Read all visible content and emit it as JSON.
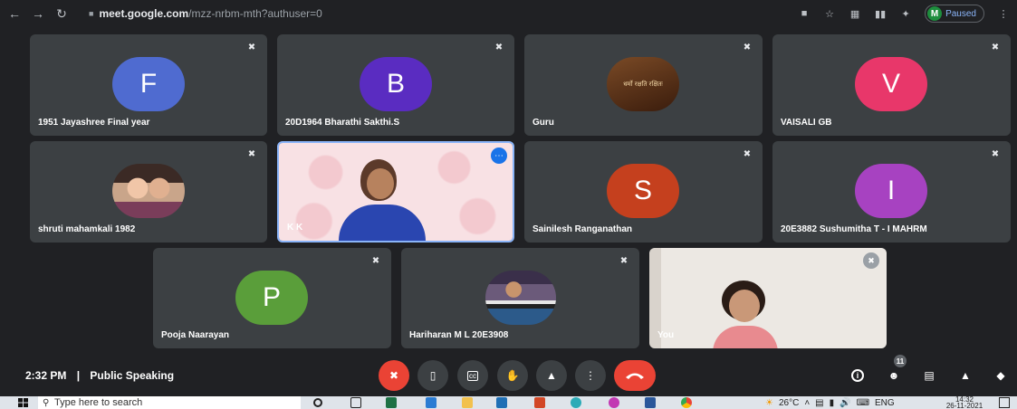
{
  "browser": {
    "url_host": "meet.google.com",
    "url_path": "/mzz-nrbm-mth?authuser=0",
    "profile_initial": "M",
    "profile_status": "Paused"
  },
  "tiles": [
    {
      "name": "1951 Jayashree Final year",
      "initial": "F",
      "color": "#4f6bd0"
    },
    {
      "name": "20D1964 Bharathi Sakthi.S",
      "initial": "B",
      "color": "#5a2cc1"
    },
    {
      "name": "Guru",
      "photo_text": "धर्मो रक्षति रक्षितः"
    },
    {
      "name": "VAISALI GB",
      "initial": "V",
      "color": "#e8376a"
    },
    {
      "name": "shruti mahamkali 1982"
    },
    {
      "name": "K K"
    },
    {
      "name": "Sainilesh Ranganathan",
      "initial": "S",
      "color": "#c5401e"
    },
    {
      "name": "20E3882 Sushumitha T - I MAHRM",
      "initial": "I",
      "color": "#a742c1"
    },
    {
      "name": "Pooja Naarayan",
      "initial": "P",
      "color": "#5a9e3a"
    },
    {
      "name": "Hariharan M L 20E3908"
    },
    {
      "name": "You"
    }
  ],
  "meeting": {
    "time": "2:32 PM",
    "separator": "|",
    "title": "Public Speaking",
    "participant_count": "11"
  },
  "taskbar": {
    "search_placeholder": "Type here to search",
    "temperature": "26°C",
    "language": "ENG",
    "time": "14:32",
    "date": "26-11-2021"
  }
}
